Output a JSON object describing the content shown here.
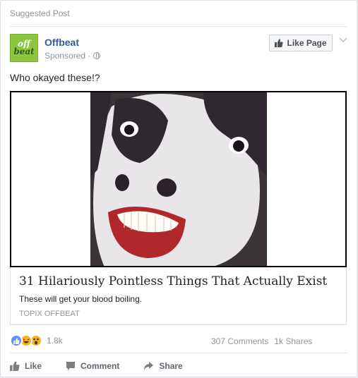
{
  "header": {
    "suggested_label": "Suggested Post"
  },
  "page": {
    "logo_line1": "off",
    "logo_line2": "beat",
    "name": "Offbeat",
    "sponsored": "Sponsored ·",
    "like_page_label": "Like Page"
  },
  "post": {
    "text": "Who okayed these!?"
  },
  "link": {
    "title": "31 Hilariously Pointless Things That Actually Exist",
    "description": "These will get your blood boiling.",
    "source": "TOPIX OFFBEAT"
  },
  "stats": {
    "reaction_count": "1.8k",
    "comments": "307 Comments",
    "shares": "1k Shares"
  },
  "actions": {
    "like": "Like",
    "comment": "Comment",
    "share": "Share"
  },
  "colors": {
    "link_blue": "#365899",
    "brand_green": "#8cc63e",
    "like_blue": "#5890ff",
    "reaction_yellow": "#f7b125"
  },
  "icons": [
    "thumbs-up-icon",
    "globe-icon",
    "chevron-down-icon",
    "comment-icon",
    "share-icon",
    "like-reaction-icon",
    "haha-reaction-icon",
    "wow-reaction-icon"
  ]
}
